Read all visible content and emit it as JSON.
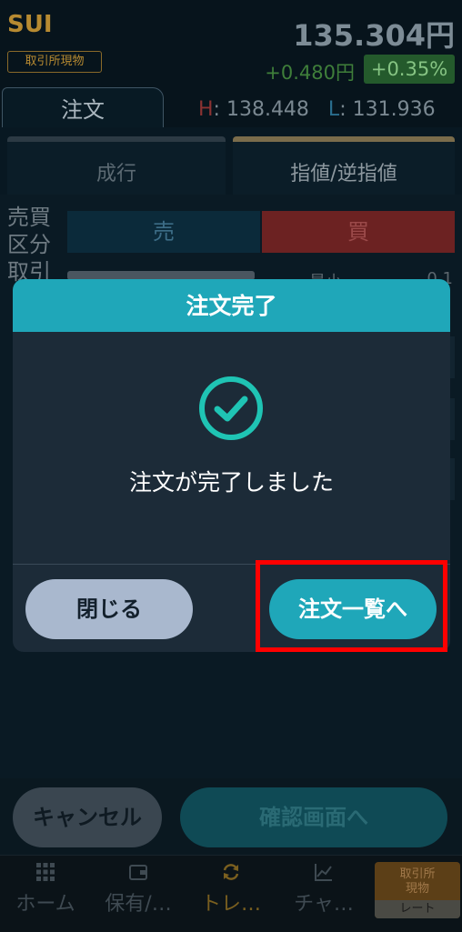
{
  "header": {
    "symbol": "SUI",
    "exchange_badge": "取引所現物",
    "price": "135.304円",
    "change": "+0.480円",
    "change_pct": "+0.35%"
  },
  "tabs": {
    "order": "注文"
  },
  "high_low": {
    "h_label": "H",
    "h_value": "138.448",
    "l_label": "L",
    "l_value": "131.936"
  },
  "order_types": {
    "market": "成行",
    "limit": "指値/逆指値"
  },
  "trade": {
    "side_label": "売買\n区分\n取引",
    "sell": "売",
    "buy": "買",
    "min_label": "最小",
    "min_value": "0.1"
  },
  "modal": {
    "title": "注文完了",
    "message": "注文が完了しました",
    "close_label": "閉じる",
    "list_label": "注文一覧へ"
  },
  "footer": {
    "cancel_label": "キャンセル",
    "confirm_label": "確認画面へ"
  },
  "nav": {
    "home": "ホーム",
    "holdings": "保有/…",
    "trade": "トレ…",
    "chart": "チャ…",
    "rate_top": "取引所\n現物",
    "rate_bottom": "レート"
  },
  "colors": {
    "accent": "#1fa7b9",
    "highlight": "#ff0000",
    "buy": "#6c2222",
    "sell": "#0b2a3a"
  }
}
